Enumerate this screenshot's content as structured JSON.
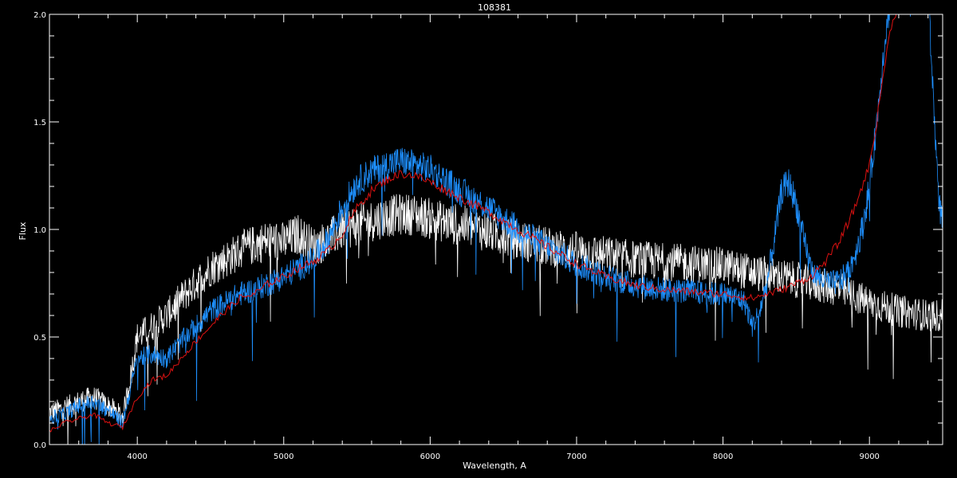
{
  "chart_data": {
    "type": "line",
    "title": "108381",
    "xlabel": "Wavelength, A",
    "ylabel": "Flux",
    "xlim": [
      3400,
      9500
    ],
    "ylim": [
      0.0,
      2.0
    ],
    "x_ticks": [
      4000,
      5000,
      6000,
      7000,
      8000,
      9000
    ],
    "x_tick_labels": [
      "4000",
      "5000",
      "6000",
      "7000",
      "8000",
      "9000"
    ],
    "y_ticks": [
      0.0,
      0.5,
      1.0,
      1.5,
      2.0
    ],
    "y_tick_labels": [
      "0.0",
      "0.5",
      "1.0",
      "1.5",
      "2.0"
    ],
    "grid": false,
    "legend": "none",
    "series": [
      {
        "color": "#ffffff",
        "noise": 0.07,
        "x": [
          3400,
          3500,
          3600,
          3700,
          3800,
          3900,
          3950,
          4000,
          4100,
          4200,
          4300,
          4400,
          4500,
          4600,
          4700,
          4800,
          4900,
          5000,
          5100,
          5200,
          5300,
          5400,
          5500,
          5600,
          5700,
          5800,
          5900,
          6000,
          6200,
          6400,
          6600,
          6800,
          7000,
          7200,
          7400,
          7600,
          7800,
          8000,
          8200,
          8400,
          8600,
          8800,
          9000,
          9200,
          9400,
          9500
        ],
        "y": [
          0.15,
          0.17,
          0.2,
          0.22,
          0.18,
          0.13,
          0.3,
          0.5,
          0.55,
          0.6,
          0.68,
          0.75,
          0.82,
          0.86,
          0.9,
          0.93,
          0.95,
          0.94,
          0.98,
          0.92,
          0.95,
          1.0,
          1.02,
          1.04,
          1.06,
          1.07,
          1.07,
          1.05,
          1.02,
          0.99,
          0.95,
          0.92,
          0.9,
          0.88,
          0.86,
          0.85,
          0.84,
          0.83,
          0.8,
          0.78,
          0.75,
          0.72,
          0.66,
          0.62,
          0.6,
          0.6
        ]
      },
      {
        "color": "#1e90ff",
        "noise": 0.05,
        "x": [
          3400,
          3500,
          3600,
          3700,
          3800,
          3900,
          3950,
          4000,
          4100,
          4200,
          4300,
          4400,
          4500,
          4600,
          4700,
          4800,
          4900,
          5000,
          5100,
          5200,
          5300,
          5400,
          5500,
          5600,
          5700,
          5800,
          5900,
          6000,
          6200,
          6400,
          6600,
          6800,
          7000,
          7200,
          7400,
          7600,
          7800,
          7900,
          8000,
          8100,
          8150,
          8200,
          8250,
          8300,
          8350,
          8400,
          8450,
          8500,
          8550,
          8600,
          8650,
          8700,
          8750,
          8800,
          8850,
          8900,
          8950,
          9000,
          9050,
          9100,
          9150,
          9200,
          9300,
          9400,
          9430,
          9460,
          9480,
          9500
        ],
        "y": [
          0.12,
          0.14,
          0.18,
          0.2,
          0.16,
          0.1,
          0.25,
          0.4,
          0.42,
          0.4,
          0.48,
          0.55,
          0.62,
          0.66,
          0.7,
          0.72,
          0.75,
          0.78,
          0.82,
          0.86,
          0.95,
          1.1,
          1.22,
          1.27,
          1.3,
          1.32,
          1.3,
          1.28,
          1.18,
          1.1,
          1.0,
          0.92,
          0.84,
          0.78,
          0.74,
          0.72,
          0.71,
          0.7,
          0.7,
          0.68,
          0.66,
          0.55,
          0.62,
          0.75,
          0.95,
          1.18,
          1.22,
          1.12,
          0.95,
          0.82,
          0.78,
          0.76,
          0.75,
          0.76,
          0.8,
          0.88,
          1.0,
          1.2,
          1.5,
          1.85,
          2.1,
          2.1,
          2.1,
          2.1,
          1.7,
          1.3,
          1.1,
          1.05
        ]
      },
      {
        "color": "#dd1111",
        "noise": 0.015,
        "x": [
          3400,
          3500,
          3600,
          3700,
          3800,
          3900,
          3950,
          4000,
          4100,
          4200,
          4300,
          4400,
          4500,
          4600,
          4700,
          4800,
          4900,
          5000,
          5100,
          5200,
          5300,
          5400,
          5500,
          5600,
          5700,
          5800,
          5900,
          6000,
          6200,
          6400,
          6600,
          6800,
          7000,
          7200,
          7400,
          7600,
          7800,
          8000,
          8100,
          8200,
          8300,
          8400,
          8500,
          8600,
          8700,
          8800,
          8900,
          9000,
          9050,
          9100,
          9150,
          9200
        ],
        "y": [
          0.06,
          0.1,
          0.12,
          0.14,
          0.1,
          0.08,
          0.15,
          0.22,
          0.3,
          0.32,
          0.4,
          0.48,
          0.55,
          0.62,
          0.68,
          0.7,
          0.75,
          0.78,
          0.82,
          0.85,
          0.9,
          0.98,
          1.1,
          1.18,
          1.23,
          1.26,
          1.25,
          1.22,
          1.15,
          1.08,
          1.0,
          0.92,
          0.84,
          0.78,
          0.74,
          0.72,
          0.71,
          0.7,
          0.69,
          0.68,
          0.7,
          0.72,
          0.75,
          0.78,
          0.85,
          0.95,
          1.1,
          1.3,
          1.5,
          1.75,
          1.95,
          2.05
        ]
      }
    ]
  }
}
